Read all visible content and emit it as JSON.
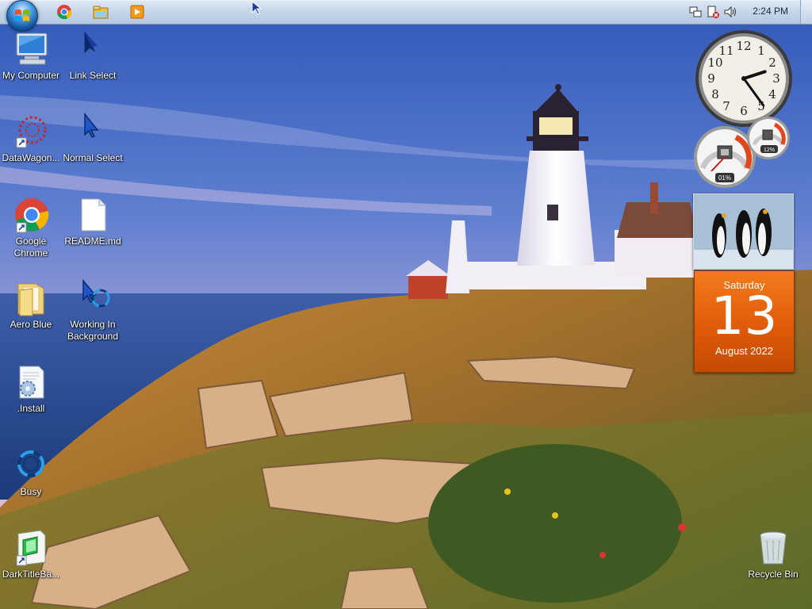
{
  "taskbar": {
    "start_button": "start-orb",
    "pinned": [
      {
        "name": "chrome-icon"
      },
      {
        "name": "file-explorer-icon"
      },
      {
        "name": "media-player-icon"
      }
    ],
    "tray": {
      "icons": [
        "network-icon",
        "action-center-icon",
        "volume-icon"
      ],
      "time": "2:24 PM"
    }
  },
  "desktop": {
    "icons": [
      {
        "label": "My Computer",
        "icon": "computer-icon"
      },
      {
        "label": "Link Select",
        "icon": "link-select-cursor-icon"
      },
      {
        "label": "DataWagon...",
        "icon": "datawagon-icon"
      },
      {
        "label": "Normal Select",
        "icon": "normal-select-cursor-icon"
      },
      {
        "label": "Google Chrome",
        "icon": "chrome-icon"
      },
      {
        "label": "README.md",
        "icon": "document-icon"
      },
      {
        "label": "Aero Blue",
        "icon": "folder-icon"
      },
      {
        "label": "Working In Background",
        "icon": "working-cursor-icon"
      },
      {
        "label": ".Install",
        "icon": "install-file-icon"
      },
      {
        "label": "Busy",
        "icon": "busy-cursor-icon"
      },
      {
        "label": "DarkTitleBa...",
        "icon": "dark-title-bar-icon"
      },
      {
        "label": "Recycle Bin",
        "icon": "recycle-bin-icon"
      }
    ]
  },
  "gadgets": {
    "clock": {
      "hour": 2,
      "minute": 24
    },
    "cpu_meter": {
      "cpu": "01%",
      "memory": "12%"
    },
    "calendar": {
      "weekday": "Saturday",
      "day": "13",
      "month_year": "August 2022"
    }
  }
}
